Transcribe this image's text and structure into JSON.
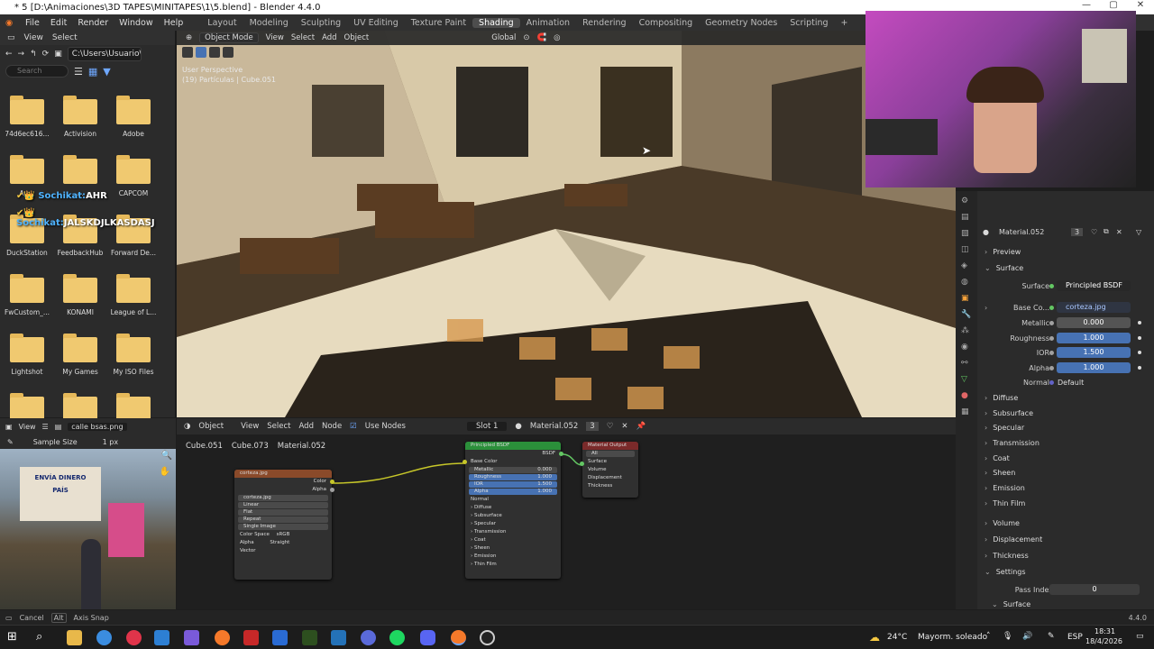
{
  "window": {
    "title": "* 5 [D:\\Animaciones\\3D TAPES\\MINITAPES\\1\\5.blend] - Blender 4.4.0",
    "controls": [
      "—",
      "▢",
      "✕"
    ]
  },
  "menu": {
    "items": [
      "File",
      "Edit",
      "Render",
      "Window",
      "Help"
    ],
    "workspaces": [
      "Layout",
      "Modeling",
      "Sculpting",
      "UV Editing",
      "Texture Paint",
      "Shading",
      "Animation",
      "Rendering",
      "Compositing",
      "Geometry Nodes",
      "Scripting",
      "+"
    ],
    "active_workspace": "Shading"
  },
  "file_browser": {
    "header": [
      "View",
      "Select"
    ],
    "path": "C:\\Users\\Usuario\\D...",
    "search_placeholder": "Search",
    "folders": [
      "74d6ec616...",
      "Activision",
      "Adobe",
      "Au...",
      "...",
      "CAPCOM",
      "DuckStation",
      "FeedbackHub",
      "Forward De...",
      "FwCustom_...",
      "KONAMI",
      "League of L...",
      "Lightshot",
      "My Games",
      "My ISO Files",
      "",
      "",
      ""
    ]
  },
  "chat_overlay": [
    {
      "user": "Sochikat:",
      "msg": "AHR"
    },
    {
      "user": "Sochikat:",
      "msg": "JALSKDJLKASDASJ"
    }
  ],
  "viewport": {
    "mode": "Object Mode",
    "menus": [
      "View",
      "Select",
      "Add",
      "Object"
    ],
    "orientation": "Global",
    "info_line1": "User Perspective",
    "info_line2": "(19) Partículas | Cube.051"
  },
  "image_editor": {
    "menu": "View",
    "image_name": "calle bsas.png",
    "sample_label": "Sample Size",
    "sample_value": "1 px",
    "sign_text1": "ENVÍA DINERO",
    "sign_text2": "PAÍS"
  },
  "node_editor": {
    "object_menu": "Object",
    "menus": [
      "View",
      "Select",
      "Add",
      "Node"
    ],
    "use_nodes_label": "Use Nodes",
    "slot": "Slot 1",
    "material": "Material.052",
    "users": "3",
    "breadcrumb": [
      "Cube.051",
      "Cube.073",
      "Material.052"
    ],
    "image_node": {
      "title": "corteza.jpg",
      "out_color": "Color",
      "out_alpha": "Alpha",
      "file": "corteza.jpg",
      "options": [
        "Linear",
        "Flat",
        "Repeat",
        "Single Image"
      ],
      "color_space_label": "Color Space",
      "color_space": "sRGB",
      "alpha_label": "Alpha",
      "alpha": "Straight",
      "vector": "Vector"
    },
    "bsdf_node": {
      "title": "Principled BSDF",
      "out": "BSDF",
      "base_color": "Base Color",
      "fields": [
        {
          "label": "Metallic",
          "value": "0.000",
          "blue": false
        },
        {
          "label": "Roughness",
          "value": "1.000",
          "blue": true
        },
        {
          "label": "IOR",
          "value": "1.500",
          "blue": true
        },
        {
          "label": "Alpha",
          "value": "1.000",
          "blue": true
        }
      ],
      "normal": "Normal",
      "sections": [
        "Diffuse",
        "Subsurface",
        "Specular",
        "Transmission",
        "Coat",
        "Sheen",
        "Emission",
        "Thin Film"
      ]
    },
    "output_node": {
      "title": "Material Output",
      "target": "All",
      "inputs": [
        "Surface",
        "Volume",
        "Displacement",
        "Thickness"
      ]
    }
  },
  "properties": {
    "material": "Material.052",
    "users": "3",
    "preview": "Preview",
    "surface_section": "Surface",
    "surface_label": "Surface",
    "surface_value": "Principled BSDF",
    "base_color_label": "Base Co...",
    "base_color_value": "corteza.jpg",
    "fields": [
      {
        "label": "Metallic",
        "value": "0.000",
        "blue": false
      },
      {
        "label": "Roughness",
        "value": "1.000",
        "blue": true
      },
      {
        "label": "IOR",
        "value": "1.500",
        "blue": true
      },
      {
        "label": "Alpha",
        "value": "1.000",
        "blue": true
      }
    ],
    "normal_label": "Normal",
    "normal_value": "Default",
    "sections": [
      "Diffuse",
      "Subsurface",
      "Specular",
      "Transmission",
      "Coat",
      "Sheen",
      "Emission",
      "Thin Film"
    ],
    "volume": "Volume",
    "displacement": "Displacement",
    "thickness": "Thickness",
    "settings": "Settings",
    "pass_index_label": "Pass Index",
    "pass_index_value": "0",
    "surface2": "Surface"
  },
  "statusbar": {
    "cancel": "Cancel",
    "alt": "Alt",
    "axis_snap": "Axis Snap",
    "version": "4.4.0"
  },
  "taskbar": {
    "weather_temp": "24°C",
    "weather_text": "Mayorm. soleado",
    "lang": "ESP",
    "time": "18:31",
    "date": "18/4/2026"
  },
  "colors": {
    "accent_blue": "#4772b3",
    "header": "#303030",
    "panel": "#2b2b2b",
    "folder": "#f0c970",
    "bsdf_header": "#2b8f3a",
    "image_node_header": "#8a4a2a",
    "output_header": "#7a2a2a"
  }
}
